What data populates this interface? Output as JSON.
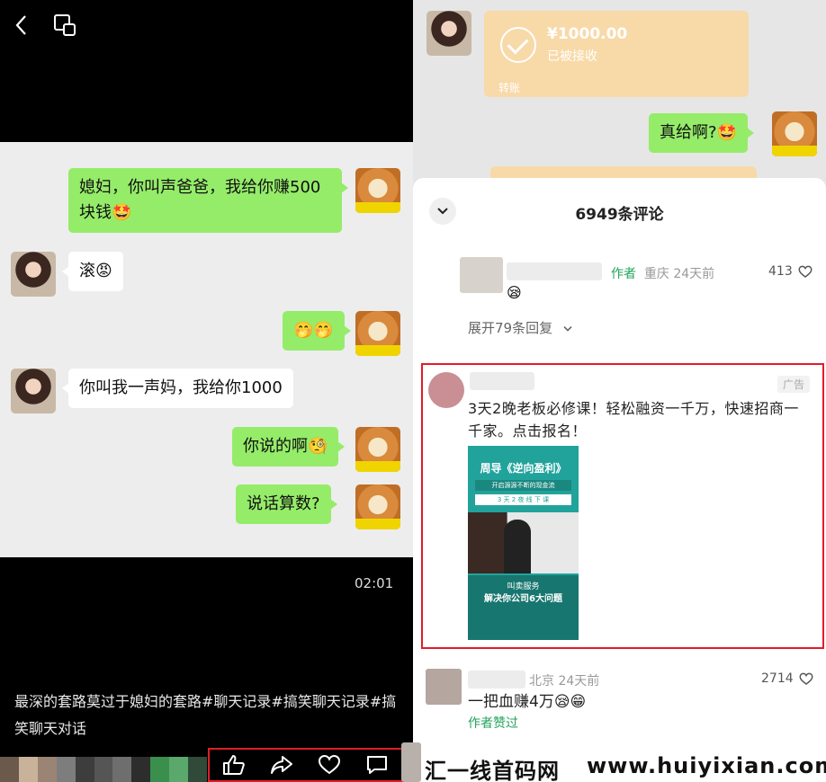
{
  "left": {
    "messages": [
      {
        "side": "right",
        "text": "媳妇，你叫声爸爸，我给你赚500块钱🤩"
      },
      {
        "side": "left",
        "text": "滚😡"
      },
      {
        "side": "right",
        "text": "🤭🤭"
      },
      {
        "side": "left",
        "text": "你叫我一声妈，我给你1000"
      },
      {
        "side": "right",
        "text": "你说的啊🧐"
      },
      {
        "side": "right",
        "text": "说话算数?"
      }
    ],
    "timecode": "02:01",
    "caption": "最深的套路莫过于媳妇的套路#聊天记录#搞笑聊天记录#搞笑聊天对话",
    "strip_colors": [
      "#6b5a4c",
      "#c8b29a",
      "#9a8474",
      "#7d7d7d",
      "#3d3d3d",
      "#555555",
      "#6e6e6e",
      "#2d2d2d",
      "#3a8f4d",
      "#5aa86b",
      "#2f4a38"
    ]
  },
  "right": {
    "transfer": {
      "amount": "¥1000.00",
      "status": "已被接收",
      "type": "转账"
    },
    "reply_message": "真给啊?🤩",
    "comments_title": "6949条评论",
    "comment1": {
      "author_tag": "作者",
      "location_time": "重庆 24天前",
      "likes": "413",
      "expand": "展开79条回复"
    },
    "ad": {
      "badge": "广告",
      "text": "3天2晚老板必修课！轻松融资一千万，快速招商一千家。点击报名！",
      "poster_title": "周导《逆向盈利》",
      "poster_line1": "开启源源不断的现金流",
      "poster_line2": "3 天 2 夜 线 下 课",
      "poster_foot1": "叫卖服务",
      "poster_foot2": "解决你公司6大问题"
    },
    "comment2": {
      "location_time": "北京 24天前",
      "likes": "2714",
      "text": "一把血赚4万😪😁",
      "liked_by": "作者赞过"
    },
    "watermark_cn": "汇一线首码网",
    "watermark_url": "www.huiyixian.com"
  }
}
